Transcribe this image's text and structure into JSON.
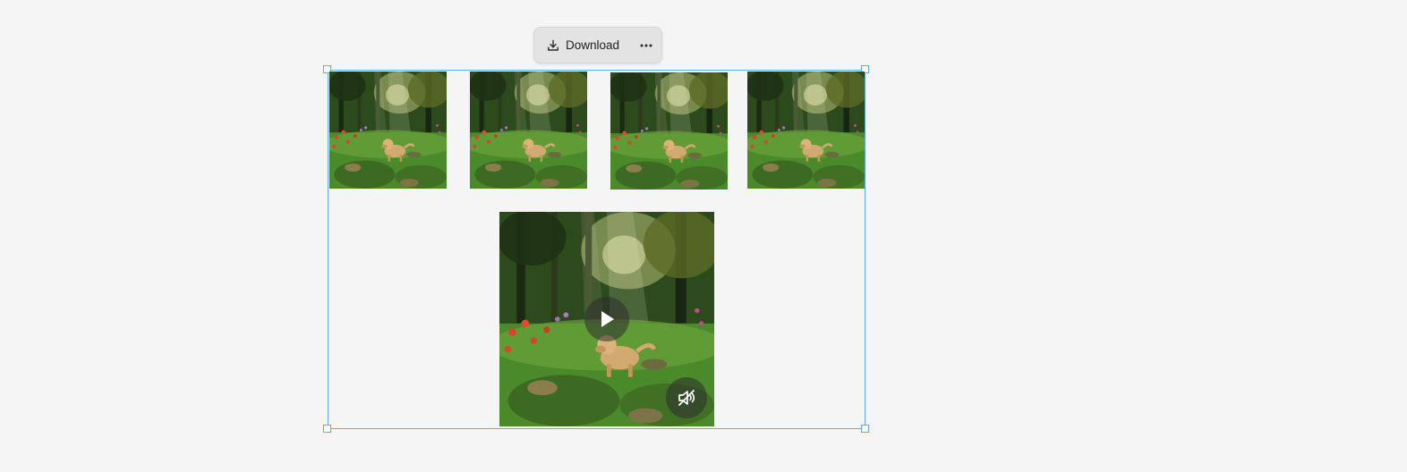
{
  "toolbar": {
    "download_label": "Download",
    "download_icon": "download-icon",
    "more_icon": "more-horizontal-icon"
  },
  "gallery": {
    "thumbnails": [
      {
        "icon": "image-thumbnail"
      },
      {
        "icon": "image-thumbnail"
      },
      {
        "icon": "image-thumbnail"
      },
      {
        "icon": "image-thumbnail"
      }
    ],
    "video": {
      "play_icon": "play-icon",
      "mute_icon": "volume-muted-icon"
    }
  },
  "colors": {
    "canvas_bg": "#f5f5f5",
    "selection": "#58b0ec",
    "toolbar_bg": "#e3e3e3",
    "forest_dark": "#1f3417",
    "grass": "#4f8a2c",
    "dog": "#d2a971",
    "flower": "#d9452a"
  }
}
